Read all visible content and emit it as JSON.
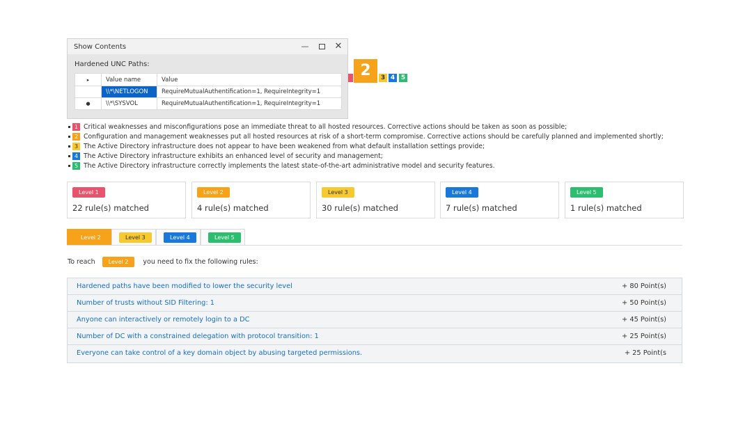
{
  "dialog": {
    "title": "Show Contents",
    "minimize": "—",
    "close": "✕",
    "subtitle": "Hardened UNC Paths:",
    "columns": {
      "mark": "▸",
      "name": "Value name",
      "value": "Value"
    },
    "rows": [
      {
        "mark": "",
        "name": "\\\\*\\NETLOGON",
        "value": "RequireMutualAuthentification=1,   RequireIntegrity=1"
      },
      {
        "mark": "●",
        "name": "\\\\*\\SYSVOL",
        "value": "RequireMutualAuthentification=1,   RequireIntegrity=1"
      }
    ]
  },
  "current_level": "2",
  "level_indicators": [
    "3",
    "4",
    "5"
  ],
  "legend": [
    {
      "num": "1",
      "text": "Critical weaknesses and misconfigurations pose an immediate threat to all hosted resources. Corrective actions should be taken as soon as possible;"
    },
    {
      "num": "2",
      "text": "Configuration and management weaknesses put all hosted resources at risk of a short-term compromise. Corrective actions should be carefully planned and implemented shortly;"
    },
    {
      "num": "3",
      "text": "The Active Directory infrastructure does not appear to have been weakened from what default installation settings provide;"
    },
    {
      "num": "4",
      "text": "The Active Directory infrastructure exhibits an enhanced level of security and management;"
    },
    {
      "num": "5",
      "text": "The Active Directory infrastructure correctly implements the latest state-of-the-art administrative model and security features."
    }
  ],
  "cards": [
    {
      "label": "Level 1",
      "text": "22 rule(s) matched"
    },
    {
      "label": "Level 2",
      "text": "4 rule(s) matched"
    },
    {
      "label": "Level 3",
      "text": "30 rule(s) matched"
    },
    {
      "label": "Level 4",
      "text": "7 rule(s) matched"
    },
    {
      "label": "Level 5",
      "text": "1 rule(s) matched"
    }
  ],
  "tabs": [
    "Level 2",
    "Level 3",
    "Level 4",
    "Level 5"
  ],
  "reach": {
    "prefix": "To reach",
    "level": "Level 2",
    "suffix": "you need to fix the following rules:"
  },
  "rules": [
    {
      "name": "Hardened paths have been modified to lower the security level",
      "points": "+ 80 Point(s)"
    },
    {
      "name": "Number of trusts without SID Filtering: 1",
      "points": "+ 50 Point(s)"
    },
    {
      "name": "Anyone can interactively or remotely login to a DC",
      "points": "+ 45 Point(s)"
    },
    {
      "name": "Number of DC with a constrained delegation with protocol transition: 1",
      "points": "+ 25 Point(s)"
    },
    {
      "name": "Everyone can take control of a key domain object by abusing targeted permissions.",
      "points": "+ 25 Point(s"
    }
  ],
  "colors": {
    "level1": "#e8546b",
    "level2": "#f7a21b",
    "level3": "#f5c92f",
    "level4": "#1a78d8",
    "level5": "#2dbd6e",
    "link": "#1a6fbf",
    "selection": "#0a64c8"
  }
}
